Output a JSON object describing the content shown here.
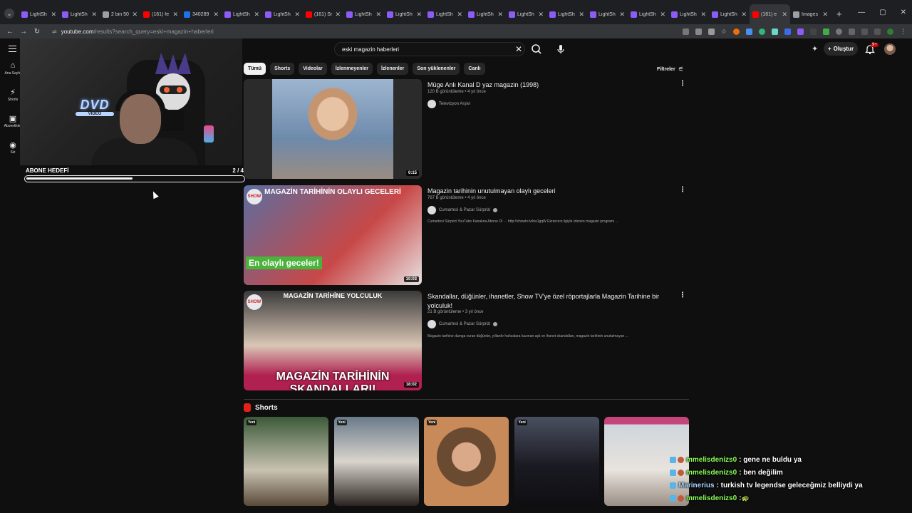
{
  "browser": {
    "tabs": [
      {
        "title": "LightSh",
        "color": "#8b5cf6",
        "active": false
      },
      {
        "title": "LightSh",
        "color": "#8b5cf6",
        "active": false
      },
      {
        "title": "2 bin 50",
        "color": "#9aa0a6",
        "active": false
      },
      {
        "title": "(161) fe",
        "color": "#ff0000",
        "active": false
      },
      {
        "title": "340289",
        "color": "#1a73e8",
        "active": false
      },
      {
        "title": "LightSh",
        "color": "#8b5cf6",
        "active": false
      },
      {
        "title": "LightSh",
        "color": "#8b5cf6",
        "active": false
      },
      {
        "title": "(161) Sr",
        "color": "#ff0000",
        "active": false
      },
      {
        "title": "LightSh",
        "color": "#8b5cf6",
        "active": false
      },
      {
        "title": "LightSh",
        "color": "#8b5cf6",
        "active": false
      },
      {
        "title": "LightSh",
        "color": "#8b5cf6",
        "active": false
      },
      {
        "title": "LightSh",
        "color": "#8b5cf6",
        "active": false
      },
      {
        "title": "LightSh",
        "color": "#8b5cf6",
        "active": false
      },
      {
        "title": "LightSh",
        "color": "#8b5cf6",
        "active": false
      },
      {
        "title": "LightSh",
        "color": "#8b5cf6",
        "active": false
      },
      {
        "title": "LightSh",
        "color": "#8b5cf6",
        "active": false
      },
      {
        "title": "LightSh",
        "color": "#8b5cf6",
        "active": false
      },
      {
        "title": "LightSh",
        "color": "#8b5cf6",
        "active": false
      },
      {
        "title": "(161) e",
        "color": "#ff0000",
        "active": true
      },
      {
        "title": "Images",
        "color": "#9aa0a6",
        "active": false
      }
    ],
    "url_host": "youtube.com",
    "url_path": "/results?search_query=eski+magazin+haberleri"
  },
  "youtube": {
    "search_value": "eski magazin haberleri",
    "create_label": "Oluştur",
    "notif_count": "9+",
    "nav": [
      {
        "icon": "⌂",
        "label": "Ana Sayfa",
        "name": "home"
      },
      {
        "icon": "⚡",
        "label": "Shorts",
        "name": "shorts"
      },
      {
        "icon": "▣",
        "label": "Abonelikler",
        "name": "subscriptions"
      },
      {
        "icon": "◉",
        "label": "Siz",
        "name": "you"
      }
    ],
    "chips": [
      "Tümü",
      "Shorts",
      "Videolar",
      "İzlenmeyenler",
      "İzlenenler",
      "Son yüklenenler",
      "Canlı"
    ],
    "filters_label": "Filtreler",
    "results": [
      {
        "title": "Müge Anlı Kanal D yaz magazin (1998)",
        "meta": "120 B görüntüleme • 4 yıl önce",
        "channel": "Televizyon Arşivi",
        "verified": false,
        "description": "",
        "duration": "0:15"
      },
      {
        "title": "Magazin tarihinin unutulmayan olaylı geceleri",
        "meta": "767 B görüntüleme • 4 yıl önce",
        "channel": "Cumartesi & Pazar Sürprizi",
        "verified": true,
        "description": "Cumartesi Sürprizi YouTube Kanalına Abone Ol → http://showtv.tv/bw1gqW Ekranının ilgiyle izlenen magazin programı ...",
        "duration": "10:03",
        "thumb_banner": "MAGAZİN TARİHİNİN OLAYLI GECELERİ",
        "thumb_label": "En olaylı geceler!"
      },
      {
        "title": "Skandallar, düğünler, ihanetler, Show TV'ye özel röportajlarla Magazin Tarihine bir yolculuk!",
        "meta": "21 B görüntüleme • 3 yıl önce",
        "channel": "Cumartesi & Pazar Sürprizi",
        "verified": true,
        "description": "Magazin tarihine damga vuran düğünler, yıllardır hafızalara kazınan aşk ve ihanet skandalları, magazin tarihinin unutulmayan ...",
        "duration": "18:02",
        "thumb_banner": "MAGAZİN TARİHİNE YOLCULUK",
        "thumb_caption": "MAGAZİN TARİHİNİN SKANDALLARI!"
      }
    ],
    "shorts_heading": "Shorts",
    "shorts": [
      {
        "badge": "Yeni",
        "bg": "linear-gradient(#3c5a3a,#c9c2b0 60%,#5a4a3a)"
      },
      {
        "badge": "Yeni",
        "bg": "linear-gradient(#6a7a8a,#d9d4cc 50%,#2a2320)"
      },
      {
        "badge": "Yeni",
        "bg": "radial-gradient(circle at 50% 45%,#d9a98a 0 22%,#6a4a30 23% 45%,#c98a5a 46%)"
      },
      {
        "badge": "Yeni",
        "bg": "linear-gradient(#4a5060,#1a1a22 55%,#0e0e12)"
      },
      {
        "badge": "",
        "bg": "linear-gradient(#c4457a 0 8%,#cfd6dd 9%,#e8e3dd 60%,#9a8e84)"
      }
    ]
  },
  "overlay": {
    "goal_title": "ABONE HEDEFİ",
    "goal_current": "2",
    "goal_target": "4",
    "goal_progress": 0.5,
    "dvd_text": "DVD",
    "dvd_sub": "VIDEO",
    "chat": [
      {
        "user": "mmelisdenizs0",
        "text": ": gene ne buldu ya",
        "color": "#8cff5a"
      },
      {
        "user": "mmelisdenizs0",
        "text": ": ben değilim",
        "color": "#8cff5a"
      },
      {
        "user": "Marinerius",
        "text": ": turkish tv legendse geleceğmiz belliydi ya",
        "color": "#a9d7ff"
      },
      {
        "user": "mmelisdenizs0",
        "text": ": ",
        "color": "#8cff5a",
        "emote": "🐢"
      }
    ]
  }
}
